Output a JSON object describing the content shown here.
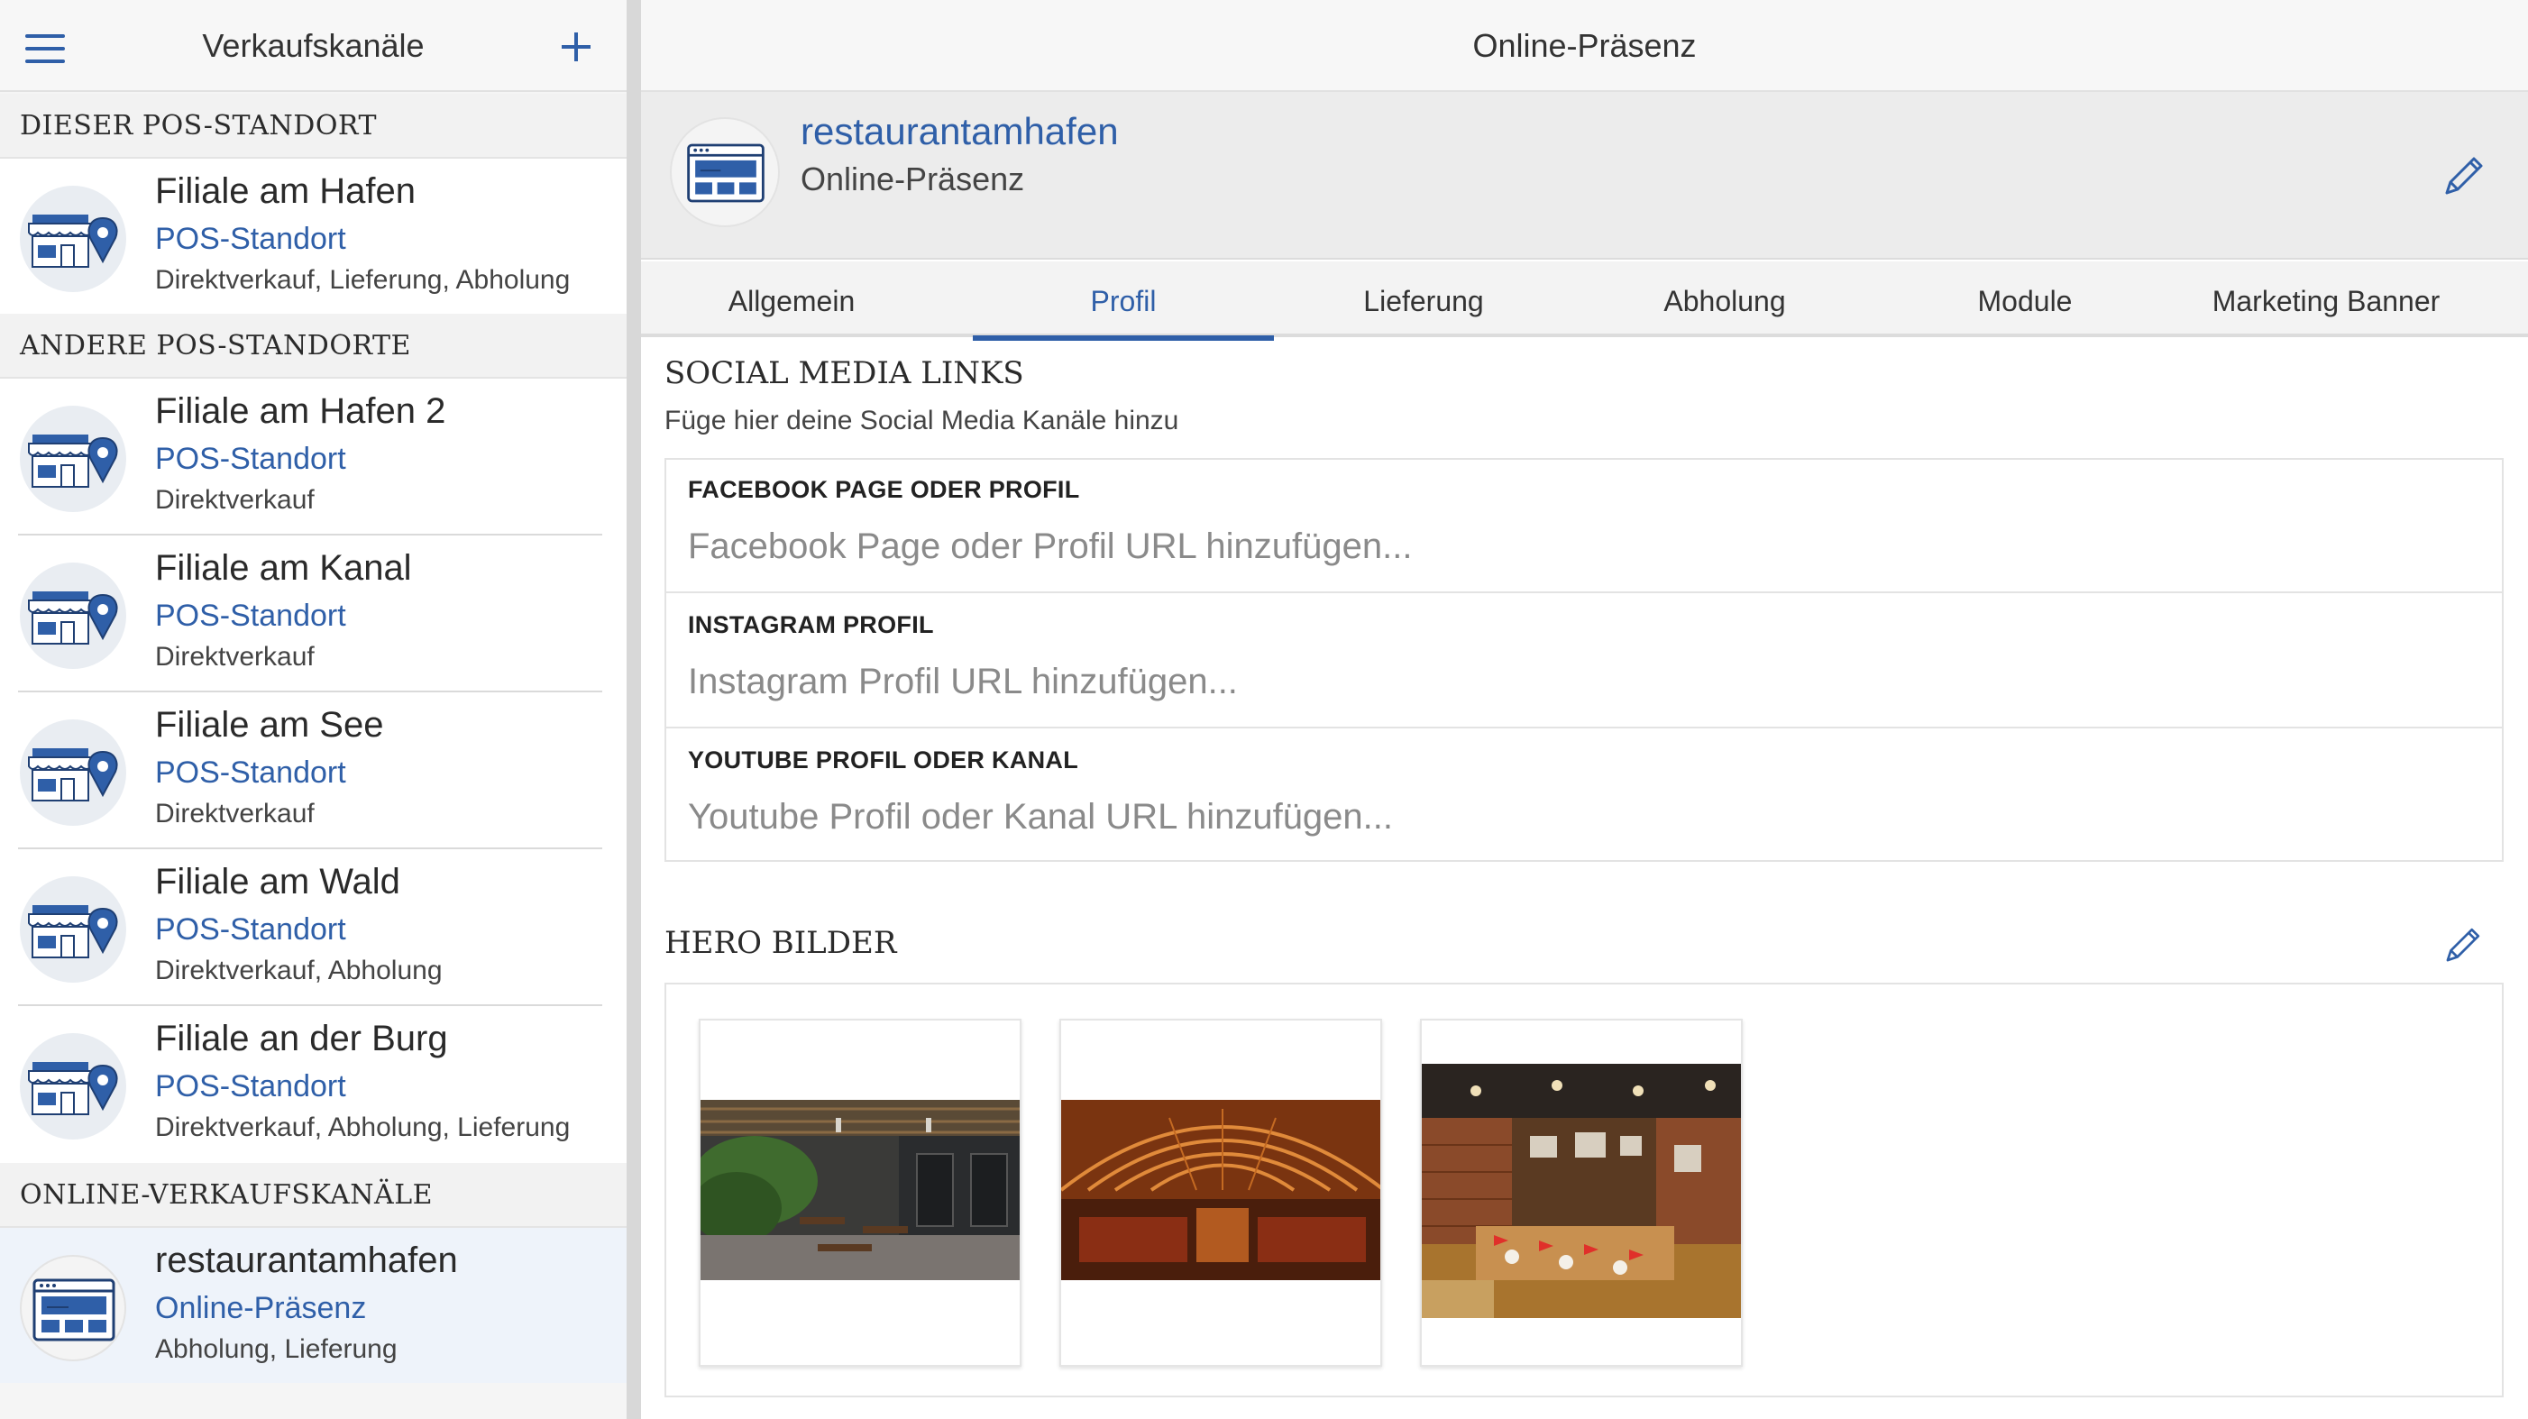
{
  "sidebar": {
    "title": "Verkaufskanäle",
    "sections": {
      "this_pos": "DIESER POS-STANDORT",
      "other_pos": "ANDERE POS-STANDORTE",
      "online": "ONLINE-VERKAUFSKANÄLE"
    },
    "current": {
      "name": "Filiale am Hafen",
      "type": "POS-Standort",
      "desc": "Direktverkauf, Lieferung, Abholung"
    },
    "others": [
      {
        "name": "Filiale am Hafen 2",
        "type": "POS-Standort",
        "desc": "Direktverkauf"
      },
      {
        "name": "Filiale am Kanal",
        "type": "POS-Standort",
        "desc": "Direktverkauf"
      },
      {
        "name": "Filiale am See",
        "type": "POS-Standort",
        "desc": "Direktverkauf"
      },
      {
        "name": "Filiale am Wald",
        "type": "POS-Standort",
        "desc": "Direktverkauf, Abholung"
      },
      {
        "name": "Filiale an der Burg",
        "type": "POS-Standort",
        "desc": "Direktverkauf, Abholung, Lieferung"
      }
    ],
    "online": {
      "name": "restaurantamhafen",
      "type": "Online-Präsenz",
      "desc": "Abholung, Lieferung"
    }
  },
  "main": {
    "title": "Online-Präsenz",
    "profile": {
      "name": "restaurantamhafen",
      "type": "Online-Präsenz"
    },
    "tabs": [
      "Allgemein",
      "Profil",
      "Lieferung",
      "Abholung",
      "Module",
      "Marketing Banner"
    ],
    "active_tab": "Profil",
    "social": {
      "title": "SOCIAL MEDIA LINKS",
      "subtitle": "Füge hier deine Social Media Kanäle hinzu",
      "fields": [
        {
          "label": "FACEBOOK PAGE ODER PROFIL",
          "placeholder": "Facebook Page oder Profil URL hinzufügen...",
          "value": ""
        },
        {
          "label": "INSTAGRAM PROFIL",
          "placeholder": "Instagram Profil URL hinzufügen...",
          "value": ""
        },
        {
          "label": "YOUTUBE PROFIL ODER KANAL",
          "placeholder": "Youtube Profil oder Kanal URL hinzufügen...",
          "value": ""
        }
      ]
    },
    "hero": {
      "title": "HERO BILDER",
      "images": [
        "restaurant-interior-plants",
        "restaurant-interior-wooden-arches",
        "restaurant-interior-brick-dining"
      ]
    }
  },
  "colors": {
    "accent": "#2f5fa8",
    "selected_bg": "#eef3fa",
    "banner_bg": "#ececec"
  }
}
